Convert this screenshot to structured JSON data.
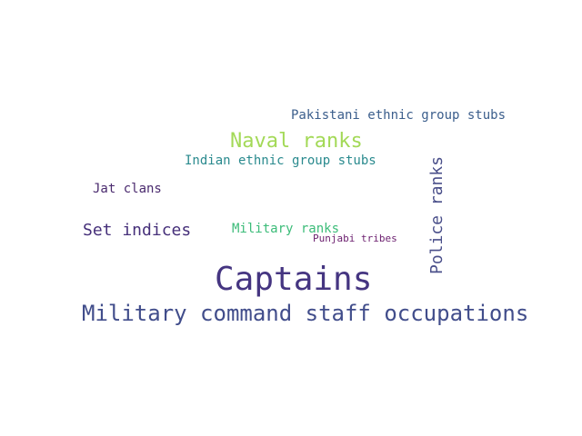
{
  "words": [
    {
      "text": "Pakistani ethnic group stubs",
      "color": "#3b5e8c"
    },
    {
      "text": "Naval ranks",
      "color": "#a3d957"
    },
    {
      "text": "Indian ethnic group stubs",
      "color": "#2a8a8e"
    },
    {
      "text": "Jat clans",
      "color": "#4a2a6e"
    },
    {
      "text": "Set indices",
      "color": "#46307a"
    },
    {
      "text": "Military ranks",
      "color": "#3cbc79"
    },
    {
      "text": "Punjabi tribes",
      "color": "#6b1e6e"
    },
    {
      "text": "Captains",
      "color": "#453581"
    },
    {
      "text": "Military command staff occupations",
      "color": "#414d8b"
    },
    {
      "text": "Police ranks",
      "color": "#4a4f8a"
    }
  ]
}
